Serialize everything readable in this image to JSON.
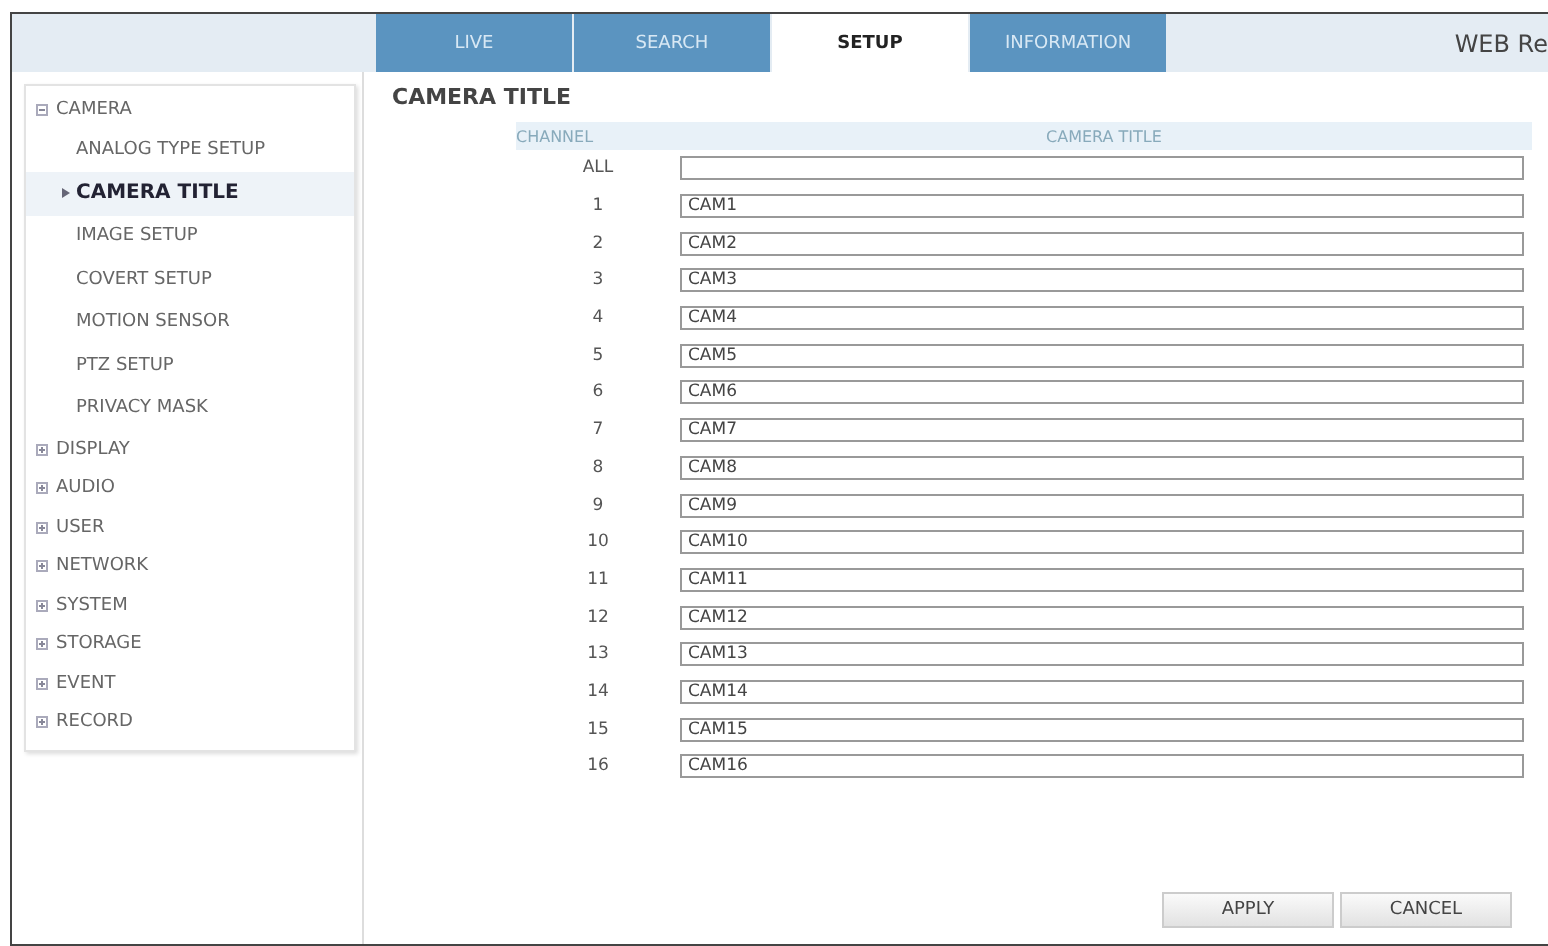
{
  "tabs": [
    {
      "label": "LIVE",
      "selected": false
    },
    {
      "label": "SEARCH",
      "selected": false
    },
    {
      "label": "SETUP",
      "selected": true
    },
    {
      "label": "INFORMATION",
      "selected": false
    }
  ],
  "brand": "WEB Re",
  "sidebar": {
    "items": [
      {
        "label": "CAMERA",
        "expanded": true,
        "children": [
          {
            "label": "ANALOG TYPE SETUP",
            "selected": false
          },
          {
            "label": "CAMERA TITLE",
            "selected": true
          },
          {
            "label": "IMAGE SETUP",
            "selected": false
          },
          {
            "label": "COVERT SETUP",
            "selected": false
          },
          {
            "label": "MOTION SENSOR",
            "selected": false
          },
          {
            "label": "PTZ SETUP",
            "selected": false
          },
          {
            "label": "PRIVACY MASK",
            "selected": false
          }
        ]
      },
      {
        "label": "DISPLAY",
        "expanded": false
      },
      {
        "label": "AUDIO",
        "expanded": false
      },
      {
        "label": "USER",
        "expanded": false
      },
      {
        "label": "NETWORK",
        "expanded": false
      },
      {
        "label": "SYSTEM",
        "expanded": false
      },
      {
        "label": "STORAGE",
        "expanded": false
      },
      {
        "label": "EVENT",
        "expanded": false
      },
      {
        "label": "RECORD",
        "expanded": false
      }
    ]
  },
  "page_title": "CAMERA TITLE",
  "table": {
    "columns": [
      "CHANNEL",
      "CAMERA TITLE"
    ],
    "rows": [
      {
        "channel": "ALL",
        "title": ""
      },
      {
        "channel": "1",
        "title": "CAM1"
      },
      {
        "channel": "2",
        "title": "CAM2"
      },
      {
        "channel": "3",
        "title": "CAM3"
      },
      {
        "channel": "4",
        "title": "CAM4"
      },
      {
        "channel": "5",
        "title": "CAM5"
      },
      {
        "channel": "6",
        "title": "CAM6"
      },
      {
        "channel": "7",
        "title": "CAM7"
      },
      {
        "channel": "8",
        "title": "CAM8"
      },
      {
        "channel": "9",
        "title": "CAM9"
      },
      {
        "channel": "10",
        "title": "CAM10"
      },
      {
        "channel": "11",
        "title": "CAM11"
      },
      {
        "channel": "12",
        "title": "CAM12"
      },
      {
        "channel": "13",
        "title": "CAM13"
      },
      {
        "channel": "14",
        "title": "CAM14"
      },
      {
        "channel": "15",
        "title": "CAM15"
      },
      {
        "channel": "16",
        "title": "CAM16"
      }
    ]
  },
  "buttons": [
    "APPLY",
    "CANCEL"
  ]
}
